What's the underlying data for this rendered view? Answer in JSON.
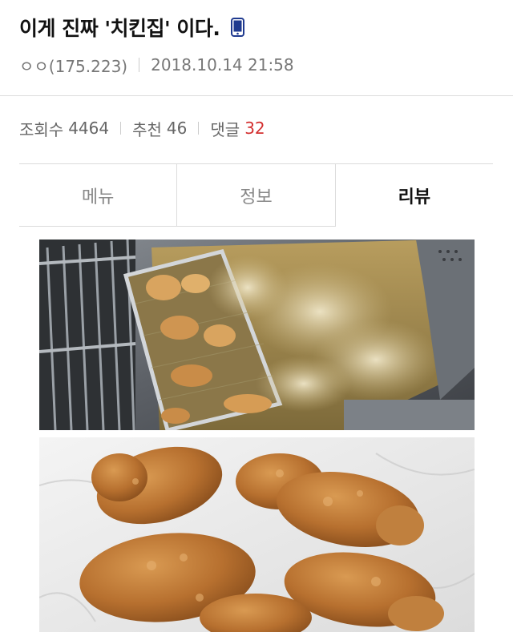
{
  "post": {
    "title": "이게 진짜 '치킨집' 이다.",
    "author": "ㅇㅇ(175.223)",
    "datetime": "2018.10.14 21:58"
  },
  "stats": {
    "views_label": "조회수",
    "views": "4464",
    "recommend_label": "추천",
    "recommend": "46",
    "comments_label": "댓글",
    "comments": "32"
  },
  "tabs": [
    {
      "label": "메뉴"
    },
    {
      "label": "정보"
    },
    {
      "label": "리뷰"
    }
  ],
  "colors": {
    "accent_red": "#d32f2f",
    "phone_icon": "#1f3a8f"
  },
  "icons": {
    "device": "mobile-phone-icon"
  }
}
